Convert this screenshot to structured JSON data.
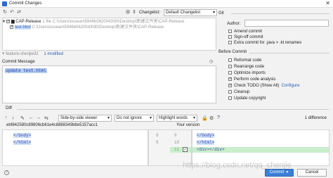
{
  "window": {
    "title": "Commit Changes",
    "close_glyph": "✕"
  },
  "toolbar": {
    "changelist_label": "Changelist:",
    "changelist_value": "Default Changelist"
  },
  "tree": {
    "root_name": "CAP-Release",
    "root_meta": "1 file  C:\\Users\\ossean\\5946b0620043\\90\\Desktop\\新建文件夹\\CAP-Release",
    "file_name": "test.html",
    "file_path": "C:\\Users\\ossean\\5946b0620043\\90\\Desktop\\新建文件夹\\CAP-Release"
  },
  "status": {
    "branch": "feature-chenjie32",
    "modified": "1 modified"
  },
  "commit_message": {
    "label": "Commit Message",
    "text": "update test.html"
  },
  "git": {
    "title": "Git",
    "author_label": "Author:",
    "author_value": "",
    "options": [
      {
        "label": "Amend commit",
        "checked": false
      },
      {
        "label": "Sign-off commit",
        "checked": false
      },
      {
        "label": "Extra commit for .java > .kt renames",
        "checked": false
      }
    ]
  },
  "before_commit": {
    "title": "Before Commit",
    "options": [
      {
        "label": "Reformat code",
        "checked": false
      },
      {
        "label": "Rearrange code",
        "checked": false
      },
      {
        "label": "Optimize imports",
        "checked": false
      },
      {
        "label": "Perform code analysis",
        "checked": true
      },
      {
        "label": "Check TODO (Show All)",
        "checked": true,
        "link": "Configure"
      },
      {
        "label": "Cleanup",
        "checked": false
      },
      {
        "label": "Update copyright",
        "checked": false
      }
    ]
  },
  "diff": {
    "label": "Diff",
    "viewer": "Side-by-side viewer",
    "whitespace": "Do not ignore",
    "highlight": "Highlight words",
    "count": "1 difference",
    "left_hash": "ebf842580c89806cb61e4c8888349b8e5157acc1",
    "right_title": "Your version",
    "left_lines": [
      "</body>",
      "</html>"
    ],
    "gutter_left_numbers": [
      "8",
      "9"
    ],
    "gutter_right_numbers": [
      "9",
      "10",
      "11"
    ],
    "right_lines": [
      "</body>",
      "</html>",
      "<div></div>"
    ]
  },
  "buttons": {
    "commit": "Commit",
    "cancel": "Cancel",
    "help": "?"
  },
  "watermark": "https://blog.csdn.net/qq_chenjie"
}
